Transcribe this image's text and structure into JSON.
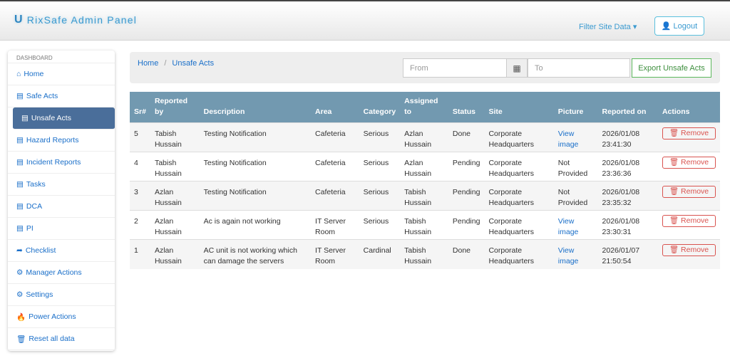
{
  "header": {
    "brand": "RixSafe Admin Panel",
    "filter": "Filter Site Data",
    "logout": "Logout"
  },
  "sidebar": {
    "heading": "DASHBOARD",
    "items": [
      {
        "label": "Home",
        "icon": "⌂"
      },
      {
        "label": "Safe Acts",
        "icon": "▤"
      },
      {
        "label": "Unsafe Acts",
        "icon": "▤"
      },
      {
        "label": "Hazard Reports",
        "icon": "▤"
      },
      {
        "label": "Incident Reports",
        "icon": "▤"
      },
      {
        "label": "Tasks",
        "icon": "▤"
      },
      {
        "label": "DCA",
        "icon": "▤"
      },
      {
        "label": "PI",
        "icon": "▤"
      },
      {
        "label": "Checklist",
        "icon": "➦"
      },
      {
        "label": "Manager Actions",
        "icon": "⚙"
      },
      {
        "label": "Settings",
        "icon": "⚙"
      },
      {
        "label": "Power Actions",
        "icon": "🔥"
      },
      {
        "label": "Reset all data",
        "icon": "🗑"
      }
    ]
  },
  "breadcrumb": {
    "home": "Home",
    "current": "Unsafe Acts"
  },
  "toolbar": {
    "from_placeholder": "From",
    "to_placeholder": "To",
    "export": "Export Unsafe Acts"
  },
  "table": {
    "headers": [
      "Sr#",
      "Reported by",
      "Description",
      "Area",
      "Category",
      "Assigned to",
      "Status",
      "Site",
      "Picture",
      "Reported on",
      "Actions"
    ],
    "rows": [
      {
        "sr": "5",
        "by": "Tabish Hussain",
        "desc": "Testing Notification",
        "area": "Cafeteria",
        "cat": "Serious",
        "to": "Azlan Hussain",
        "status": "Done",
        "site": "Corporate Headquarters",
        "pic": "View image",
        "pic_link": true,
        "date": "2026/01/08 23:41:30",
        "action": "Remove"
      },
      {
        "sr": "4",
        "by": "Tabish Hussain",
        "desc": "Testing Notification",
        "area": "Cafeteria",
        "cat": "Serious",
        "to": "Azlan Hussain",
        "status": "Pending",
        "site": "Corporate Headquarters",
        "pic": "Not Provided",
        "pic_link": false,
        "date": "2026/01/08 23:36:36",
        "action": "Remove"
      },
      {
        "sr": "3",
        "by": "Azlan Hussain",
        "desc": "Testing Notification",
        "area": "Cafeteria",
        "cat": "Serious",
        "to": "Tabish Hussain",
        "status": "Pending",
        "site": "Corporate Headquarters",
        "pic": "Not Provided",
        "pic_link": false,
        "date": "2026/01/08 23:35:32",
        "action": "Remove"
      },
      {
        "sr": "2",
        "by": "Azlan Hussain",
        "desc": "Ac is again not working",
        "area": "IT Server Room",
        "cat": "Serious",
        "to": "Tabish Hussain",
        "status": "Pending",
        "site": "Corporate Headquarters",
        "pic": "View image",
        "pic_link": true,
        "date": "2026/01/08 23:30:31",
        "action": "Remove"
      },
      {
        "sr": "1",
        "by": "Azlan Hussain",
        "desc": "AC unit is not working which can damage the servers",
        "area": "IT Server Room",
        "cat": "Cardinal",
        "to": "Tabish Hussain",
        "status": "Done",
        "site": "Corporate Headquarters",
        "pic": "View image",
        "pic_link": true,
        "date": "2026/01/07 21:50:54",
        "action": "Remove"
      }
    ]
  }
}
